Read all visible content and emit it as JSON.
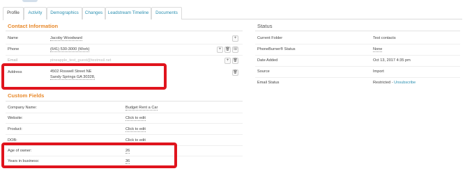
{
  "tabs": [
    {
      "label": "Profile"
    },
    {
      "label": "Activity"
    },
    {
      "label": "Demographics"
    },
    {
      "label": "Changes"
    },
    {
      "label": "Leadstream Timeline"
    },
    {
      "label": "Documents"
    }
  ],
  "contact": {
    "title": "Contact Information",
    "rows": [
      {
        "label": "Name",
        "value": "Jacoby Woodward"
      },
      {
        "label": "Phone",
        "value": "(641) 530-3000 (Work)"
      },
      {
        "label": "Email",
        "value": "pineapple_test_guest@testmail.net"
      },
      {
        "label": "Address",
        "line1": "4502 Roswell Street NE",
        "line2": "Sandy Springs GA 30328,"
      }
    ]
  },
  "custom": {
    "title": "Custom Fields",
    "rows": [
      {
        "label": "Company Name:",
        "value": "Budget Rent a Car"
      },
      {
        "label": "Website:",
        "value": "Click to edit"
      },
      {
        "label": "Product:",
        "value": "Click to edit"
      },
      {
        "label": "DOB:",
        "value": "Click to edit"
      },
      {
        "label": "Age of owner:",
        "value": "26"
      },
      {
        "label": "Years in business:",
        "value": "36"
      }
    ]
  },
  "status": {
    "title": "Status",
    "rows": [
      {
        "label": "Current Folder",
        "value": "Test contacts"
      },
      {
        "label": "PhoneBurner® Status",
        "value": "None"
      },
      {
        "label": "Date Added",
        "value": "Oct 13, 2017 4:35 pm"
      },
      {
        "label": "Source",
        "value": "Import"
      },
      {
        "label": "Email Status",
        "value": "Restricted - ",
        "link": "Unsubscribe"
      }
    ]
  },
  "icons": {
    "plus": "+",
    "trash": "🗑",
    "phone": "☏"
  },
  "colors": {
    "accent": "#e8892b",
    "link": "#2a8fb0",
    "highlight": "#e0141d"
  }
}
